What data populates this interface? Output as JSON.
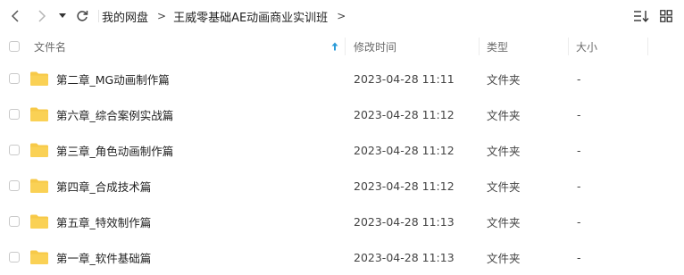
{
  "breadcrumb": {
    "root": "我的网盘",
    "separator": ">",
    "current": "王威零基础AE动画商业实训班"
  },
  "header": {
    "name": "文件名",
    "modified": "修改时间",
    "type": "类型",
    "size": "大小"
  },
  "files": [
    {
      "name": "第二章_MG动画制作篇",
      "modified": "2023-04-28 11:11",
      "type": "文件夹",
      "size": "-"
    },
    {
      "name": "第六章_综合案例实战篇",
      "modified": "2023-04-28 11:12",
      "type": "文件夹",
      "size": "-"
    },
    {
      "name": "第三章_角色动画制作篇",
      "modified": "2023-04-28 11:12",
      "type": "文件夹",
      "size": "-"
    },
    {
      "name": "第四章_合成技术篇",
      "modified": "2023-04-28 11:12",
      "type": "文件夹",
      "size": "-"
    },
    {
      "name": "第五章_特效制作篇",
      "modified": "2023-04-28 11:13",
      "type": "文件夹",
      "size": "-"
    },
    {
      "name": "第一章_软件基础篇",
      "modified": "2023-04-28 11:13",
      "type": "文件夹",
      "size": "-"
    }
  ],
  "icons": {
    "back": "arrow-left-icon",
    "forward": "arrow-right-icon",
    "dropdown": "caret-down-icon",
    "refresh": "refresh-icon",
    "sort": "sort-icon",
    "grid": "grid-view-icon",
    "sort_arrow": "arrow-up-icon",
    "folder": "folder-icon"
  },
  "colors": {
    "folder": "#F7C948",
    "sort_arrow": "#2B9BD8"
  }
}
